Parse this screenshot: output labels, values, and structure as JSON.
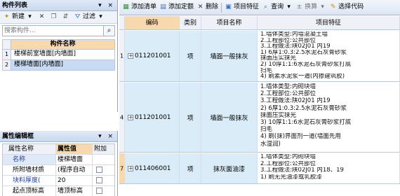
{
  "component_panel": {
    "title": "构件列表",
    "title_controls": "▾ ×",
    "toolbar": {
      "new_label": "新建",
      "filter_label": "过滤"
    },
    "search": {
      "placeholder": "搜索构件..."
    },
    "column_header": "构件名称",
    "rows": [
      {
        "num": "1",
        "name": "楼梯前室墙面[内墙面]"
      },
      {
        "num": "2",
        "name": "楼梯墙面[内墙面]"
      }
    ]
  },
  "property_panel": {
    "title": "属性编辑框",
    "title_controls": "▾ ×",
    "headers": {
      "name": "属性名称",
      "value": "属性值",
      "extra": "附加"
    },
    "rows": [
      {
        "name": "名称",
        "value": "楼梯墙面",
        "has_check": false
      },
      {
        "name": "所附墙材质",
        "value": "(程序自动",
        "has_check": true
      },
      {
        "name": "块料厚度(",
        "value": "20",
        "has_check": true
      },
      {
        "name": "起点顶标高",
        "value": "墙顶标高",
        "has_check": true
      }
    ]
  },
  "main_toolbar": {
    "add_list": "添加清单",
    "add_quota": "添加定额",
    "delete": "删除",
    "item_feature": "项目特征",
    "query": "查询",
    "convert": "换算",
    "select_code": "选择代码"
  },
  "main_table": {
    "headers": {
      "code": "编码",
      "category": "类别",
      "name": "项目名称",
      "feature": "项目特征"
    },
    "rows": [
      {
        "num": "1",
        "code": "011201001",
        "category": "项",
        "name": "墙面一般抹灰",
        "feature": [
          "1.墙体类型:内墙混凝土墙",
          "2.工程部位:公共部位",
          "3.工程做法:陕02J01 内19",
          "1) 6厚1:0.3:2.5水泥石灰膏砂浆",
          "抹面压实抹光",
          "2) 10厚1:1:6水泥石灰膏砂浆打底",
          "扫毛",
          "4) 刷素水泥浆一道(内掺建筑胶)"
        ]
      },
      {
        "num": "4",
        "code": "011201001",
        "category": "项",
        "name": "墙面一般抹灰",
        "feature": [
          "1.墙体类型:内砌块墙",
          "2.工程部位:公共部位",
          "3.工程做法:陕02J01 内19",
          "2) 6厚1:0.3:2.5水泥石灰膏砂浆",
          "抹面压实抹光",
          "3) 10厚1:1:6水泥石灰膏砂浆打底",
          "扫毛",
          "4) 刷(抹)界面剂一道(墙面先用",
          "水湿润)"
        ]
      },
      {
        "num": "7",
        "code": "011406001",
        "category": "项",
        "name": "抹灰面油漆",
        "feature": [
          "1.墙体类型:内砌块墙",
          "2.工程部位:公共部位",
          "3.工程做法:陕02J01 内18、19",
          "1) 刷无光油漆或乳胶漆"
        ]
      }
    ]
  },
  "colors": {
    "header_orange": "#f8d9ae",
    "row_blue": "#d9ecf7",
    "selected_blue": "#c8dbf5",
    "panel_title": "#c9d9ef"
  }
}
